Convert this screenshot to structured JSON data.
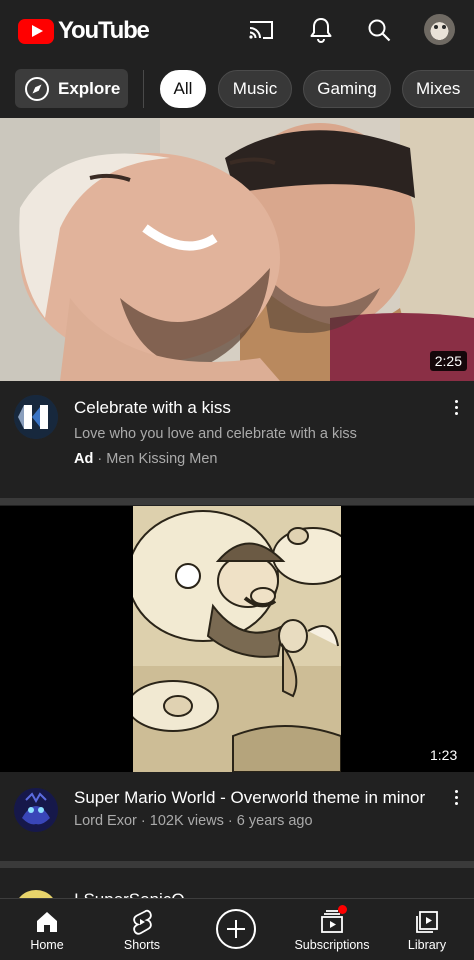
{
  "app": {
    "logo_text": "YouTube",
    "brand_color": "#ff0000"
  },
  "header": {
    "icons": [
      "cast-icon",
      "bell-icon",
      "search-icon",
      "account-avatar"
    ]
  },
  "chips": {
    "explore_label": "Explore",
    "items": [
      "All",
      "Music",
      "Gaming",
      "Mixes"
    ],
    "selected": "All"
  },
  "feed": [
    {
      "type": "ad",
      "duration": "2:25",
      "title": "Celebrate with a kiss",
      "description": "Love who you love and celebrate with a kiss",
      "ad_badge": "Ad",
      "separator": "·",
      "advertiser": "Men Kissing Men"
    },
    {
      "type": "video",
      "duration": "1:23",
      "title": "Super Mario World - Overworld theme in minor",
      "channel": "Lord Exor",
      "meta": "Lord Exor · 102K views · 6 years ago"
    },
    {
      "type": "video",
      "title": "I SuperSonicQ"
    }
  ],
  "bottom_nav": {
    "items": [
      {
        "label": "Home",
        "icon": "home-icon"
      },
      {
        "label": "Shorts",
        "icon": "shorts-icon"
      },
      {
        "label": "",
        "icon": "create-icon"
      },
      {
        "label": "Subscriptions",
        "icon": "subscriptions-icon"
      },
      {
        "label": "Library",
        "icon": "library-icon"
      }
    ]
  }
}
